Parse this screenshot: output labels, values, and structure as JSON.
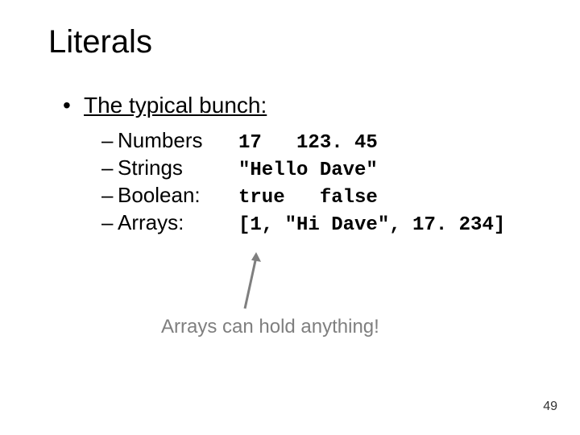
{
  "title": "Literals",
  "heading": "The typical bunch:",
  "rows": [
    {
      "label": "Numbers",
      "code": "17   123. 45"
    },
    {
      "label": "Strings",
      "code": "\"Hello Dave\""
    },
    {
      "label": "Boolean:",
      "code": "true   false"
    },
    {
      "label": "Arrays:",
      "code": "[1, \"Hi Dave\", 17. 234]"
    }
  ],
  "caption": "Arrays can hold anything!",
  "page_number": "49"
}
